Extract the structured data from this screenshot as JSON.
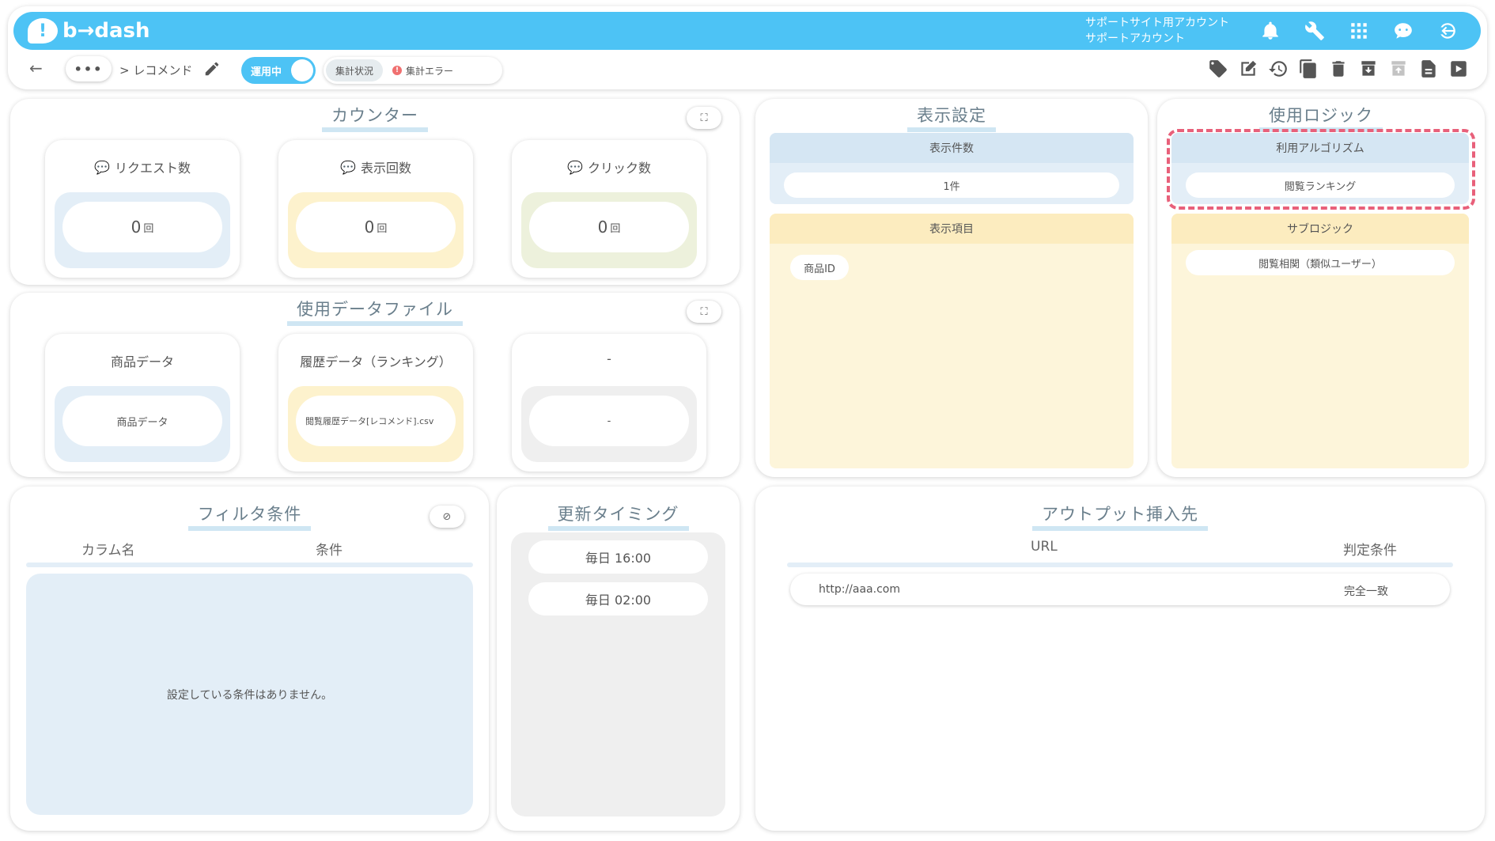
{
  "app": {
    "logo": "b→dash",
    "logo_mark": "!"
  },
  "account": {
    "line1": "サポートサイト用アカウント",
    "line2": "サポートアカウント"
  },
  "breadcrumb": {
    "dots": "•••",
    "current": "> レコメンド"
  },
  "status": {
    "toggle_label": "運用中",
    "summary_label": "集計状況",
    "error_label": "集計エラー",
    "error_mark": "!"
  },
  "counter": {
    "title": "カウンター",
    "cards": [
      {
        "label": "リクエスト数",
        "value": "0",
        "unit": "回"
      },
      {
        "label": "表示回数",
        "value": "0",
        "unit": "回"
      },
      {
        "label": "クリック数",
        "value": "0",
        "unit": "回"
      }
    ]
  },
  "datafile": {
    "title": "使用データファイル",
    "cards": [
      {
        "label": "商品データ",
        "value": "商品データ"
      },
      {
        "label": "履歴データ（ランキング）",
        "value": "閲覧履歴データ[レコメンド].csv"
      },
      {
        "label": "-",
        "value": "-"
      }
    ]
  },
  "display": {
    "title": "表示設定",
    "count_label": "表示件数",
    "count_value": "1件",
    "items_label": "表示項目",
    "items": [
      "商品ID"
    ]
  },
  "logic": {
    "title": "使用ロジック",
    "algo_label": "利用アルゴリズム",
    "algo_value": "閲覧ランキング",
    "sub_label": "サブロジック",
    "sub_value": "閲覧相関（類似ユーザー）"
  },
  "filter": {
    "title": "フィルタ条件",
    "col_name": "カラム名",
    "col_cond": "条件",
    "empty": "設定している条件はありません。"
  },
  "timing": {
    "title": "更新タイミング",
    "items": [
      "毎日 16:00",
      "毎日 02:00"
    ]
  },
  "output": {
    "title": "アウトプット挿入先",
    "col_url": "URL",
    "col_cond": "判定条件",
    "rows": [
      {
        "url": "http://aaa.com",
        "cond": "完全一致"
      }
    ]
  },
  "colors": {
    "accent": "#4dc3f5",
    "blue_well": "#e3eef7",
    "yellow_well": "#fdf2cd",
    "green_well": "#edf1dc",
    "highlight": "#e8607a"
  }
}
